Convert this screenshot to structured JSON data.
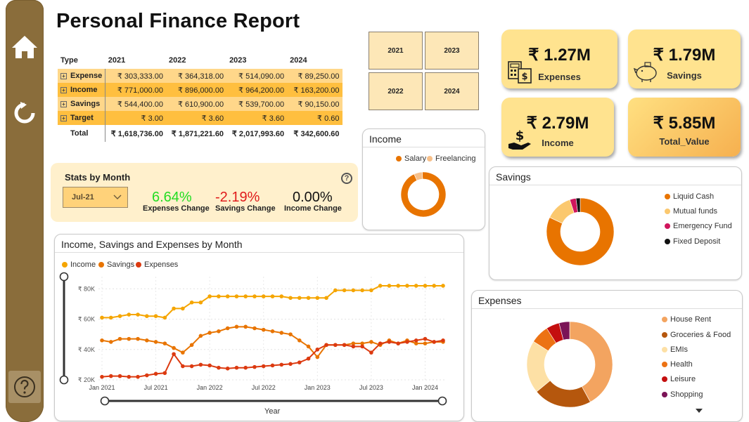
{
  "title": "Personal Finance Report",
  "matrix": {
    "header": [
      "Type",
      "2021",
      "2022",
      "2023",
      "2024"
    ],
    "rows": [
      {
        "type": "Expense",
        "values": [
          "₹ 303,333.00",
          "₹ 364,318.00",
          "₹ 514,090.00",
          "₹ 89,250.00"
        ]
      },
      {
        "type": "Income",
        "values": [
          "₹ 771,000.00",
          "₹ 896,000.00",
          "₹ 964,200.00",
          "₹ 163,200.00"
        ]
      },
      {
        "type": "Savings",
        "values": [
          "₹ 544,400.00",
          "₹ 610,900.00",
          "₹ 539,700.00",
          "₹ 90,150.00"
        ]
      },
      {
        "type": "Target",
        "values": [
          "₹ 3.00",
          "₹ 3.60",
          "₹ 3.60",
          "₹ 0.60"
        ]
      }
    ],
    "total": {
      "type": "Total",
      "values": [
        "₹ 1,618,736.00",
        "₹ 1,871,221.60",
        "₹ 2,017,993.60",
        "₹ 342,600.60"
      ]
    }
  },
  "year_slicer": [
    "2021",
    "2023",
    "2022",
    "2024"
  ],
  "kpis": {
    "expenses": {
      "value": "₹ 1.27M",
      "label": "Expenses"
    },
    "savings": {
      "value": "₹ 1.79M",
      "label": "Savings"
    },
    "income": {
      "value": "₹ 2.79M",
      "label": "Income"
    },
    "total": {
      "value": "₹ 5.85M",
      "label": "Total_Value"
    }
  },
  "stats": {
    "title": "Stats by Month",
    "month": "Jul-21",
    "expenses_change": {
      "value": "6.64%",
      "label": "Expenses Change",
      "color": "#22dd22"
    },
    "savings_change": {
      "value": "-2.19%",
      "label": "Savings Change",
      "color": "#e01b1b"
    },
    "income_change": {
      "value": "0.00%",
      "label": "Income Change",
      "color": "#111111"
    },
    "help": "?"
  },
  "colors": {
    "income": "#f5a500",
    "savings": "#e87400",
    "expenses": "#dc3a10",
    "sidebar": "#8a6d3b"
  },
  "chart_data": [
    {
      "type": "line",
      "title": "Income, Savings and Expenses by Month",
      "xlabel": "Year",
      "ylabel": "",
      "x_ticks": [
        "Jan 2021",
        "Jul 2021",
        "Jan 2022",
        "Jul 2022",
        "Jan 2023",
        "Jul 2023",
        "Jan 2024"
      ],
      "y_ticks": [
        "₹ 20K",
        "₹ 40K",
        "₹ 60K",
        "₹ 80K"
      ],
      "ylim": [
        20000,
        88000
      ],
      "x_start": "Jan 2021",
      "x_end": "Mar 2024",
      "series": [
        {
          "name": "Income",
          "color": "#f5a500",
          "values": [
            61000,
            61000,
            62000,
            63000,
            63000,
            62000,
            62000,
            61000,
            67000,
            67000,
            71000,
            71000,
            75000,
            75000,
            75000,
            75000,
            75000,
            75000,
            75000,
            75000,
            75000,
            74000,
            74000,
            74000,
            74000,
            74000,
            79000,
            79000,
            79000,
            79000,
            79000,
            82000,
            82000,
            82000,
            82000,
            82000,
            82000,
            82000,
            82000
          ]
        },
        {
          "name": "Savings",
          "color": "#e87400",
          "values": [
            46000,
            45000,
            47000,
            47000,
            47000,
            46000,
            45000,
            44000,
            41000,
            38000,
            43000,
            49000,
            51000,
            52000,
            54000,
            55000,
            55000,
            54000,
            53000,
            52000,
            51000,
            50000,
            46000,
            42000,
            35000,
            43000,
            43000,
            43000,
            44000,
            44000,
            45000,
            43000,
            46000,
            44000,
            46000,
            44000,
            44000,
            45000,
            45000
          ]
        },
        {
          "name": "Expenses",
          "color": "#dc3a10",
          "values": [
            22000,
            22500,
            22500,
            22000,
            22000,
            23000,
            24000,
            24500,
            37000,
            29000,
            29000,
            30000,
            29500,
            28000,
            27500,
            28000,
            28000,
            28500,
            29000,
            29500,
            30000,
            30500,
            31500,
            34000,
            40000,
            43000,
            43000,
            43000,
            42000,
            42000,
            38000,
            44000,
            45000,
            44000,
            45000,
            46000,
            47000,
            45000,
            46000
          ]
        }
      ]
    },
    {
      "type": "pie",
      "title": "Income",
      "labels": [
        "Salary",
        "Freelancing"
      ],
      "values": [
        94,
        6
      ],
      "colors": [
        "#e87400",
        "#f7c08a"
      ]
    },
    {
      "type": "pie",
      "title": "Savings",
      "labels": [
        "Liquid Cash",
        "Mutual funds",
        "Emergency Fund",
        "Fixed Deposit"
      ],
      "values": [
        82,
        13,
        3,
        2
      ],
      "colors": [
        "#e87400",
        "#fbc86e",
        "#d0155c",
        "#111111"
      ]
    },
    {
      "type": "pie",
      "title": "Expenses",
      "labels": [
        "House Rent",
        "Groceries & Food",
        "EMIs",
        "Health",
        "Leisure",
        "Shopping"
      ],
      "values": [
        42,
        22,
        20,
        7,
        5,
        4
      ],
      "colors": [
        "#f3a460",
        "#b5570d",
        "#fde0a5",
        "#ec7214",
        "#c40f0f",
        "#7b1457"
      ]
    }
  ]
}
